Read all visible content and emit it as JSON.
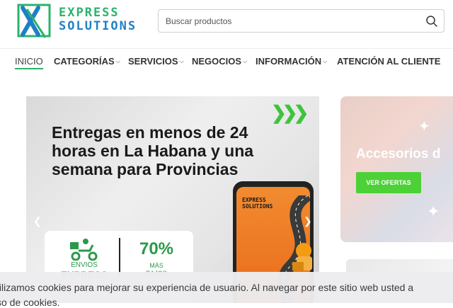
{
  "brand": {
    "line1": "EXPRESS",
    "line2": "SOLUTIONS",
    "accent_green": "#2ab36b",
    "accent_blue": "#1f7fc4"
  },
  "search": {
    "placeholder": "Buscar productos",
    "icon": "search-icon"
  },
  "nav": {
    "items": [
      {
        "label": "INICIO",
        "active": true,
        "dropdown": false
      },
      {
        "label": "CATEGORÍAS",
        "active": false,
        "dropdown": true
      },
      {
        "label": "SERVICIOS",
        "active": false,
        "dropdown": true
      },
      {
        "label": "NEGOCIOS",
        "active": false,
        "dropdown": true
      },
      {
        "label": "INFORMACIÓN",
        "active": false,
        "dropdown": true
      },
      {
        "label": "ATENCIÓN AL CLIENTE",
        "active": false,
        "dropdown": false
      }
    ]
  },
  "hero": {
    "title": "Entregas en menos de 24 horas en La Habana y una semana para Provincias",
    "arrows": "❯❯❯",
    "phone_logo_l1": "EXPRESS",
    "phone_logo_l2": "SOLUTIONS",
    "card": {
      "envios": "ENVIOS",
      "express": "EXPRESS",
      "percent": "70%",
      "mas": "MÁS",
      "bajos": "BAJOS"
    }
  },
  "side_banner": {
    "title": "Accesorios d",
    "button": "VER OFERTAS",
    "button_color": "#4cd137"
  },
  "cookie": {
    "line1": "tilizamos cookies para mejorar su experiencia de usuario. Al navegar por este sitio web usted a",
    "line2": "so de cookies."
  }
}
